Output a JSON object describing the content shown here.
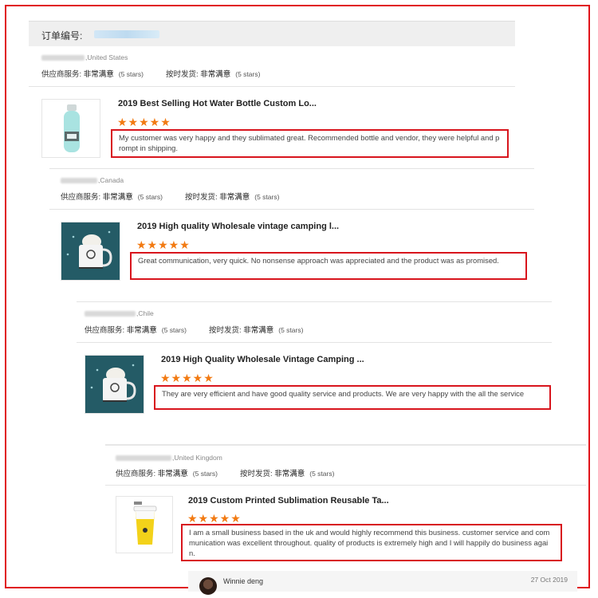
{
  "order": {
    "label": "订单编号:"
  },
  "reviews": [
    {
      "location": ",United States",
      "seller_label": "供应商服务:",
      "seller_value": "非常满意",
      "seller_count": "(5 stars)",
      "ship_label": "按时发货:",
      "ship_value": "非常满意",
      "ship_count": "(5 stars)",
      "product_title": "2019 Best Selling Hot Water Bottle Custom Lo...",
      "rating": 5,
      "rating_text": "★★★★★",
      "text": "My customer was very happy and they sublimated great. Recommended bottle and vendor, they were helpful and prompt in shipping.",
      "thumb_icon": "water-bottle-icon"
    },
    {
      "location": ",Canada",
      "seller_label": "供应商服务:",
      "seller_value": "非常满意",
      "seller_count": "(5 stars)",
      "ship_label": "按时发货:",
      "ship_value": "非常满意",
      "ship_count": "(5 stars)",
      "product_title": "2019 High quality Wholesale vintage camping l...",
      "rating": 5,
      "rating_text": "★★★★★",
      "text": "Great communication, very quick. No nonsense approach was appreciated and the product was as promised.",
      "thumb_icon": "enamel-mug-icon"
    },
    {
      "location": ",Chile",
      "seller_label": "供应商服务:",
      "seller_value": "非常满意",
      "seller_count": "(5 stars)",
      "ship_label": "按时发货:",
      "ship_value": "非常满意",
      "ship_count": "(5 stars)",
      "product_title": "2019 High Quality Wholesale Vintage Camping ...",
      "rating": 5,
      "rating_text": "★★★★★",
      "text": "They are very efficient and have good quality service and products. We are very happy with the all the service",
      "thumb_icon": "enamel-mug-icon"
    },
    {
      "location": ",United Kingdom",
      "seller_label": "供应商服务:",
      "seller_value": "非常满意",
      "seller_count": "(5 stars)",
      "ship_label": "按时发货:",
      "ship_value": "非常满意",
      "ship_count": "(5 stars)",
      "product_title": "2019 Custom Printed Sublimation Reusable Ta...",
      "rating": 5,
      "rating_text": "★★★★★",
      "text": "I am a small business based in the uk and would highly recommend this business. customer service and communication was excellent throughout. quality of products is extremely high and I will happily do business again.",
      "thumb_icon": "takeaway-cup-icon"
    }
  ],
  "reply": {
    "name": "Winnie deng",
    "date": "27 Oct 2019"
  },
  "colors": {
    "highlight": "#d8151d",
    "star": "#f27a12"
  }
}
